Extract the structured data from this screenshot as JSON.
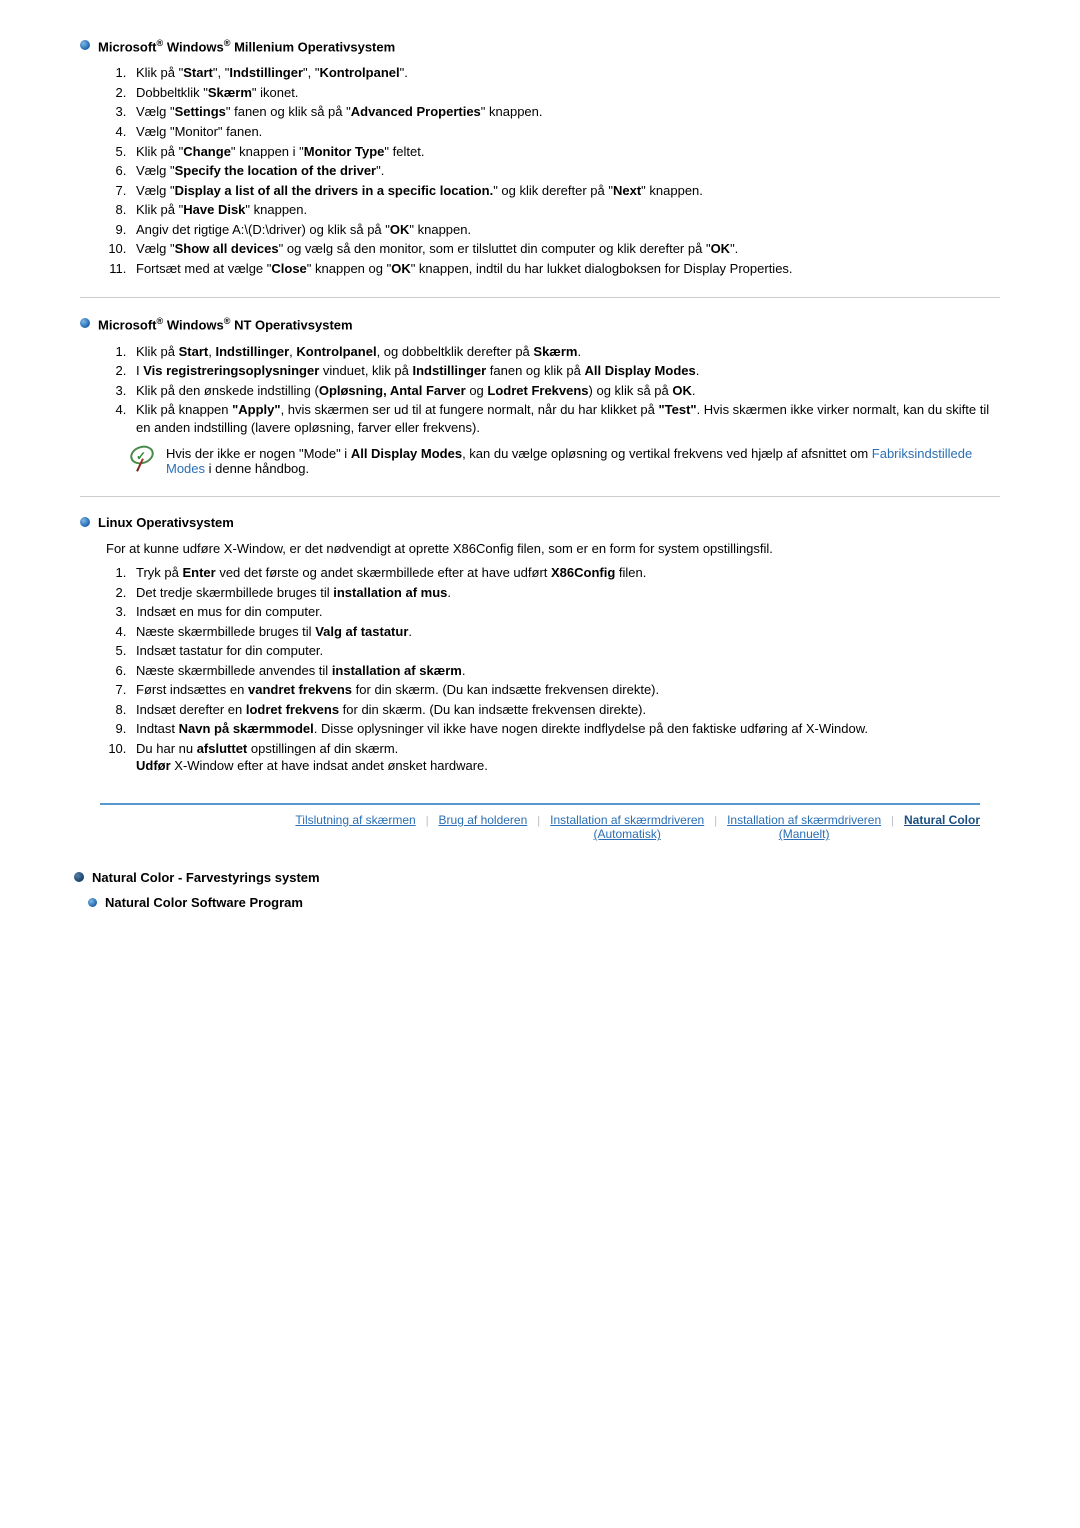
{
  "sec1": {
    "title_prefix": "Microsoft",
    "title_mid": " Windows",
    "title_suffix": " Millenium Operativsystem",
    "items": [
      "Klik på \"<b>Start</b>\", \"<b>Indstillinger</b>\", \"<b>Kontrolpanel</b>\".",
      "Dobbeltklik \"<b>Skærm</b>\" ikonet.",
      "Vælg \"<b>Settings</b>\" fanen og klik så på \"<b>Advanced Properties</b>\" knappen.",
      "Vælg \"Monitor\" fanen.",
      "Klik på \"<b>Change</b>\" knappen i \"<b>Monitor Type</b>\" feltet.",
      "Vælg \"<b>Specify the location of the driver</b>\".",
      "Vælg \"<b>Display a list of all the drivers in a specific location.</b>\" og klik derefter på \"<b>Next</b>\" knappen.",
      "Klik på \"<b>Have Disk</b>\" knappen.",
      "Angiv det rigtige A:\\(D:\\driver) og klik så på \"<b>OK</b>\" knappen.",
      "Vælg \"<b>Show all devices</b>\" og vælg så den monitor, som er tilsluttet din computer og klik derefter på \"<b>OK</b>\".",
      "Fortsæt med at vælge \"<b>Close</b>\" knappen og \"<b>OK</b>\" knappen, indtil du har lukket dialogboksen for Display Properties."
    ]
  },
  "sec2": {
    "title_prefix": "Microsoft",
    "title_mid": " Windows",
    "title_suffix": " NT Operativsystem",
    "items": [
      "Klik på <b>Start</b>, <b>Indstillinger</b>, <b>Kontrolpanel</b>, og dobbeltklik derefter på <b>Skærm</b>.",
      "I <b>Vis registreringsoplysninger</b> vinduet, klik på <b>Indstillinger</b> fanen og klik på <b>All Display Modes</b>.",
      "Klik på den ønskede indstilling (<b>Opløsning, Antal Farver</b> og <b>Lodret Frekvens</b>) og klik så på <b>OK</b>.",
      "Klik på knappen <b>\"Apply\"</b>, hvis skærmen ser ud til at fungere normalt, når du har klikket på <b>\"Test\"</b>. Hvis skærmen ikke virker normalt, kan du skifte til en anden indstilling (lavere opløsning, farver eller frekvens)."
    ],
    "note_part1": "Hvis der ikke er nogen \"Mode\" i <b>All Display Modes</b>, kan du vælge opløsning og vertikal frekvens ved hjælp af afsnittet om ",
    "note_link": "Fabriksindstillede Modes",
    "note_part2": " i denne håndbog."
  },
  "sec3": {
    "title": "Linux Operativsystem",
    "intro": "For at kunne udføre X-Window, er det nødvendigt at oprette X86Config filen, som er en form for system opstillingsfil.",
    "items": [
      "Tryk på <b>Enter</b> ved det første og andet skærmbillede efter at have udført <b>X86Config</b> filen.",
      "Det tredje skærmbillede bruges til <b>installation af mus</b>.",
      "Indsæt en mus for din computer.",
      "Næste skærmbillede bruges til <b>Valg af tastatur</b>.",
      "Indsæt tastatur for din computer.",
      "Næste skærmbillede anvendes til <b>installation af skærm</b>.",
      "Først indsættes en <b>vandret frekvens</b> for din skærm. (Du kan indsætte frekvensen direkte).",
      "Indsæt derefter en <b>lodret frekvens</b> for din skærm. (Du kan indsætte frekvensen direkte).",
      "Indtast <b>Navn på skærmmodel</b>. Disse oplysninger vil ikke have nogen direkte indflydelse på den faktiske udføring af X-Window.",
      "Du har nu <b>afsluttet</b> opstillingen af din skærm.<br><b>Udfør</b> X-Window efter at have indsat andet ønsket hardware."
    ]
  },
  "footer": {
    "items": [
      {
        "line1": "Tilslutning af skærmen",
        "line2": ""
      },
      {
        "line1": "Brug af holderen",
        "line2": ""
      },
      {
        "line1": "Installation af skærmdriveren",
        "line2": "(Automatisk)"
      },
      {
        "line1": "Installation af skærmdriveren",
        "line2": "(Manuelt)"
      },
      {
        "line1": "Natural Color",
        "line2": "",
        "bold": true
      }
    ]
  },
  "sec4": {
    "title": "Natural Color - Farvestyrings system",
    "sub": "Natural Color Software Program"
  }
}
